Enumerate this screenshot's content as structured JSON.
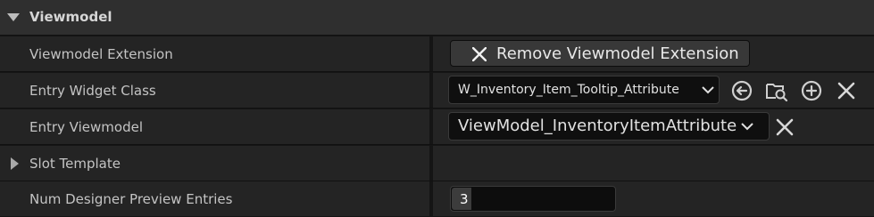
{
  "category": {
    "title": "Viewmodel",
    "expanded": true
  },
  "rows": {
    "viewmodel_extension": {
      "label": "Viewmodel Extension",
      "button_label": "Remove Viewmodel Extension",
      "button_icon": "close-icon"
    },
    "entry_widget_class": {
      "label": "Entry Widget Class",
      "value": "W_Inventory_Item_Tooltip_Attribute",
      "actions": [
        "use-selected-asset-icon",
        "browse-asset-icon",
        "create-new-icon",
        "clear-icon"
      ]
    },
    "entry_viewmodel": {
      "label": "Entry Viewmodel",
      "value": "ViewModel_InventoryItemAttribute",
      "actions": [
        "clear-icon"
      ]
    },
    "slot_template": {
      "label": "Slot Template",
      "expanded": false
    },
    "num_designer_preview_entries": {
      "label": "Num Designer Preview Entries",
      "value": "3"
    }
  },
  "colors": {
    "background": "#151515",
    "row": "#242424",
    "category": "#2f2f2f",
    "field": "#0f0f0f",
    "button": "#383838"
  }
}
